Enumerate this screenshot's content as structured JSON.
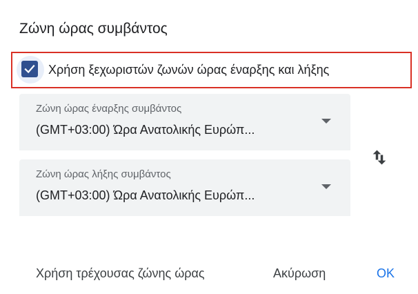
{
  "dialog": {
    "title": "Ζώνη ώρας συμβάντος",
    "separate_zones": {
      "label": "Χρήση ξεχωριστών ζωνών ώρας έναρξης και λήξης",
      "checked": true,
      "icon": "check-icon"
    },
    "start_zone": {
      "label": "Ζώνη ώρας έναρξης συμβάντος",
      "value": "(GMT+03:00) Ώρα Ανατολικής Ευρώπ...",
      "icon": "dropdown-arrow-icon"
    },
    "end_zone": {
      "label": "Ζώνη ώρας λήξης συμβάντος",
      "value": "(GMT+03:00) Ώρα Ανατολικής Ευρώπ...",
      "icon": "dropdown-arrow-icon"
    },
    "swap_icon": "swap-vertical-icon",
    "actions": {
      "use_current": "Χρήση τρέχουσας ζώνης ώρας",
      "cancel": "Ακύρωση",
      "ok": "OK"
    },
    "colors": {
      "accent": "#1a73e8",
      "checkbox": "#2f4f8f",
      "highlight_border": "#d93025",
      "field_bg": "#f1f3f4"
    }
  }
}
